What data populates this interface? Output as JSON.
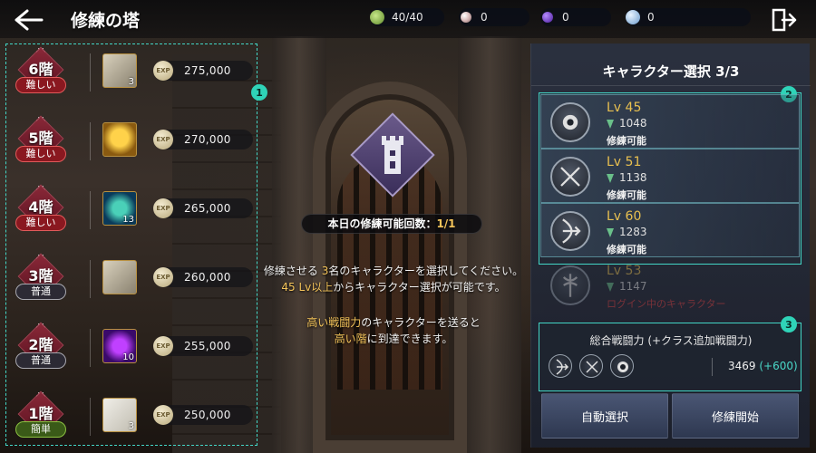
{
  "header": {
    "title": "修練の塔",
    "resources": [
      {
        "name": "stamina",
        "value": "40/40",
        "icon": "stamina-icon"
      },
      {
        "name": "pearl",
        "value": "0",
        "icon": "pearl-icon"
      },
      {
        "name": "orb",
        "value": "0",
        "icon": "orb-icon"
      },
      {
        "name": "coin",
        "value": "0",
        "icon": "coin-icon"
      }
    ]
  },
  "annotations": [
    "1",
    "2",
    "3"
  ],
  "floors": [
    {
      "label": "6階",
      "difficulty": "難しい",
      "level": "hard",
      "item": "scroll",
      "item_count": "3",
      "exp_label": "EXP",
      "exp": "275,000"
    },
    {
      "label": "5階",
      "difficulty": "難しい",
      "level": "hard",
      "item": "cup",
      "item_count": "",
      "exp_label": "EXP",
      "exp": "270,000"
    },
    {
      "label": "4階",
      "difficulty": "難しい",
      "level": "hard",
      "item": "gem-green",
      "item_count": "13",
      "exp_label": "EXP",
      "exp": "265,000"
    },
    {
      "label": "3階",
      "difficulty": "普通",
      "level": "normal",
      "item": "scroll",
      "item_count": "",
      "exp_label": "EXP",
      "exp": "260,000"
    },
    {
      "label": "2階",
      "difficulty": "普通",
      "level": "normal",
      "item": "gem-purple",
      "item_count": "10",
      "exp_label": "EXP",
      "exp": "255,000"
    },
    {
      "label": "1階",
      "difficulty": "簡単",
      "level": "easy",
      "item": "paper",
      "item_count": "3",
      "exp_label": "EXP",
      "exp": "250,000"
    }
  ],
  "center": {
    "count_label": "本日の修練可能回数：",
    "count_value": "1/1",
    "line1_a": "修練させる ",
    "line1_b": "3",
    "line1_c": "名のキャラクターを選択してください。",
    "line2_a": "45 Lv以上",
    "line2_b": "からキャラクター選択が可能です。",
    "line3_a": "高い戦闘力",
    "line3_b": "のキャラクターを送ると",
    "line4_a": "高い階",
    "line4_b": "に到達できます。"
  },
  "panel": {
    "title": "キャラクター選択 3/3",
    "characters": [
      {
        "level": "Lv 45",
        "power": "1048",
        "status": "修練可能",
        "class_icon": "beast-class-icon"
      },
      {
        "level": "Lv 51",
        "power": "1138",
        "status": "修練可能",
        "class_icon": "dual-blade-class-icon"
      },
      {
        "level": "Lv 60",
        "power": "1283",
        "status": "修練可能",
        "class_icon": "bow-class-icon"
      },
      {
        "level": "Lv 53",
        "power": "1147",
        "status": "ログイン中のキャラクター",
        "class_icon": "axe-class-icon"
      }
    ],
    "total_label": "総合戦闘力 (+クラス追加戦闘力)",
    "total_value": "3469",
    "total_bonus": "(+600)",
    "auto_select": "自動選択",
    "start": "修練開始"
  },
  "colors": {
    "accent_teal": "#43d6c6",
    "highlight_gold": "#f4c45a",
    "danger_red": "#e04040"
  }
}
